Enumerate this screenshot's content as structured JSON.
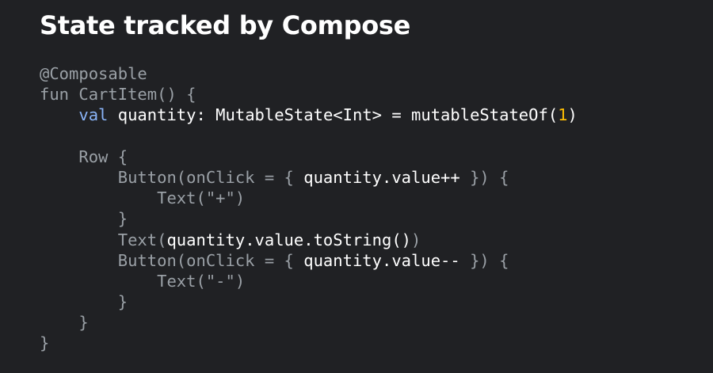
{
  "title": "State tracked by Compose",
  "colors": {
    "background": "#202124",
    "title": "#ffffff",
    "code_dim": "#9aa0a6",
    "code_highlight": "#ffffff",
    "keyword": "#8ab4f8",
    "number": "#fbbc04"
  },
  "code_lines": [
    [
      {
        "t": "@Composable",
        "s": "dim"
      }
    ],
    [
      {
        "t": "fun CartItem() {",
        "s": "dim"
      }
    ],
    [
      {
        "t": "    ",
        "s": "dim"
      },
      {
        "t": "val",
        "s": "kw"
      },
      {
        "t": " quantity",
        "s": "hi"
      },
      {
        "t": ": MutableState<Int> = mutableStateOf(",
        "s": "hi"
      },
      {
        "t": "1",
        "s": "num"
      },
      {
        "t": ")",
        "s": "hi"
      }
    ],
    [
      {
        "t": "",
        "s": "dim"
      }
    ],
    [
      {
        "t": "    Row {",
        "s": "dim"
      }
    ],
    [
      {
        "t": "        Button(onClick = { ",
        "s": "dim"
      },
      {
        "t": "quantity.value++",
        "s": "hi"
      },
      {
        "t": " }) {",
        "s": "dim"
      }
    ],
    [
      {
        "t": "            Text(\"+\")",
        "s": "dim"
      }
    ],
    [
      {
        "t": "        }",
        "s": "dim"
      }
    ],
    [
      {
        "t": "        Text(",
        "s": "dim"
      },
      {
        "t": "quantity.value.toString()",
        "s": "hi"
      },
      {
        "t": ")",
        "s": "dim"
      }
    ],
    [
      {
        "t": "        Button(onClick = { ",
        "s": "dim"
      },
      {
        "t": "quantity.value--",
        "s": "hi"
      },
      {
        "t": " }) {",
        "s": "dim"
      }
    ],
    [
      {
        "t": "            Text(\"-\")",
        "s": "dim"
      }
    ],
    [
      {
        "t": "        }",
        "s": "dim"
      }
    ],
    [
      {
        "t": "    }",
        "s": "dim"
      }
    ],
    [
      {
        "t": "}",
        "s": "dim"
      }
    ]
  ]
}
